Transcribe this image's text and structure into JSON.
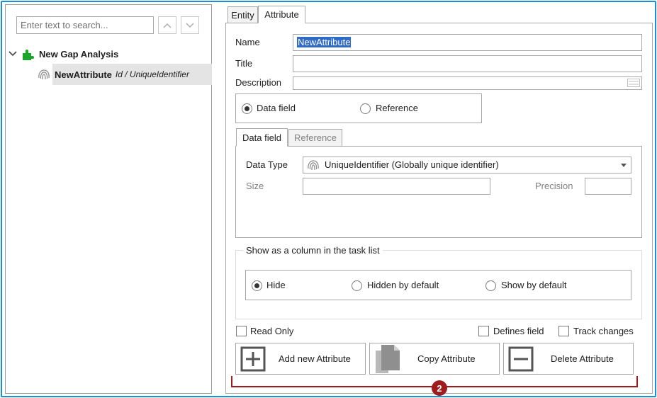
{
  "search": {
    "placeholder": "Enter text to search..."
  },
  "tree": {
    "root_label": "New Gap Analysis",
    "child_name": "NewAttribute",
    "child_type": "Id / UniqueIdentifier"
  },
  "tabs": {
    "entity": "Entity",
    "attribute": "Attribute"
  },
  "form": {
    "name_label": "Name",
    "name_value": "NewAttribute",
    "title_label": "Title",
    "title_value": "",
    "description_label": "Description",
    "description_value": "",
    "kind_options": {
      "data_field": "Data field",
      "reference": "Reference",
      "selected": "data_field"
    }
  },
  "inner_tabs": {
    "data_field": "Data field",
    "reference": "Reference"
  },
  "data_field": {
    "data_type_label": "Data Type",
    "data_type_value": "UniqueIdentifier (Globally unique identifier)",
    "size_label": "Size",
    "size_value": "",
    "precision_label": "Precision",
    "precision_value": ""
  },
  "task_list": {
    "legend": "Show as a column in the task list",
    "options": {
      "hide": "Hide",
      "hidden_by_default": "Hidden by default",
      "show_by_default": "Show by default"
    },
    "selected": "hide"
  },
  "checkboxes": {
    "read_only": {
      "label": "Read Only",
      "checked": false
    },
    "defines_field": {
      "label": "Defines field",
      "checked": false
    },
    "track_changes": {
      "label": "Track changes",
      "checked": false
    }
  },
  "actions": {
    "add": "Add new Attribute",
    "copy": "Copy Attribute",
    "delete": "Delete Attribute"
  },
  "annotation": {
    "badge": "2"
  },
  "colors": {
    "frame": "#1b8fd1",
    "selection": "#2f6bc7",
    "annotation": "#a01c1c",
    "puzzle_icon": "#1aa52b"
  }
}
